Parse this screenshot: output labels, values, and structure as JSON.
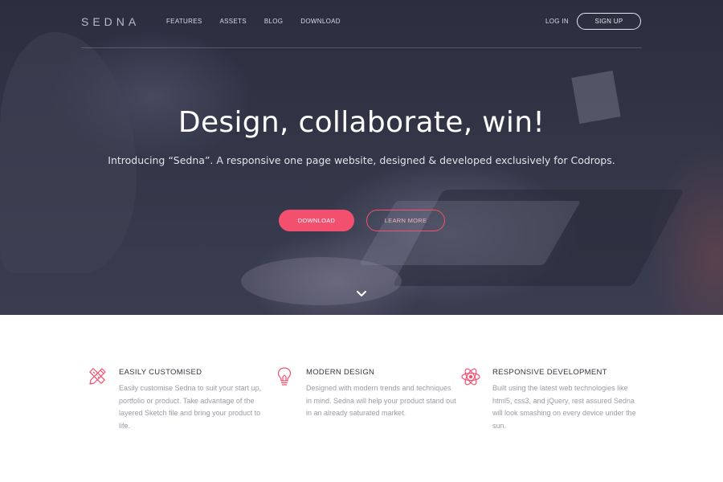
{
  "header": {
    "logo": "SEDNA",
    "nav": [
      "FEATURES",
      "ASSETS",
      "BLOG",
      "DOWNLOAD"
    ],
    "login": "LOG IN",
    "signup": "SIGN UP"
  },
  "hero": {
    "title": "Design, collaborate, win!",
    "subtitle": "Introducing “Sedna”. A responsive one page website, designed & developed exclusively for Codrops.",
    "download_label": "DOWNLOAD",
    "learn_more_label": "LEARN MORE",
    "scroll_icon": "chevron-down-icon"
  },
  "features": [
    {
      "icon": "pencil-ruler-icon",
      "title": "EASILY CUSTOMISED",
      "text": "Easily customise Sedna to suit your start up, portfolio or product. Take advantage of the layered Sketch file and bring your product to life."
    },
    {
      "icon": "lightbulb-icon",
      "title": "MODERN DESIGN",
      "text": "Designed with modern trends and techniques in mind. Sedna will help your product stand out in an already saturated market."
    },
    {
      "icon": "atom-icon",
      "title": "RESPONSIVE DEVELOPMENT",
      "text": "Built using the latest web technologies like html5, css3, and jQuery, rest assured Sedna will look smashing on every device under the sun."
    }
  ],
  "colors": {
    "accent": "#f2506e",
    "hero_bg": "#2c2e40",
    "heading": "#33363f",
    "body_text": "#9a9ca5"
  }
}
